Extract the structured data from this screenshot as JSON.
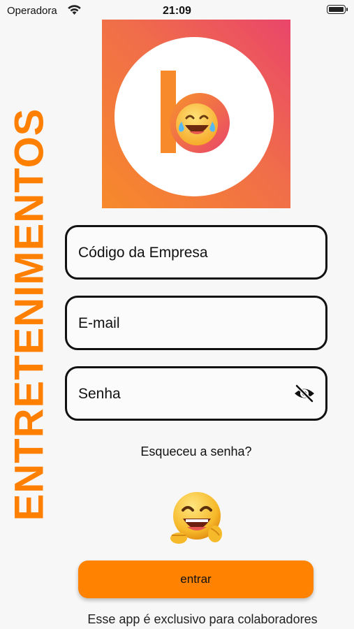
{
  "status_bar": {
    "carrier": "Operadora",
    "time": "21:09",
    "battery_level": 1.0
  },
  "brand": {
    "vertical_text": "ENTRETENIMENTOS",
    "logo_letter": "b",
    "accent_color": "#ff8200",
    "gradient_colors": [
      "#f78a2a",
      "#e9456a"
    ]
  },
  "form": {
    "company_code_placeholder": "Código da Empresa",
    "email_placeholder": "E-mail",
    "password_placeholder": "Senha",
    "password_toggle_icon": "eye-off-icon",
    "forgot_password": "Esqueceu a senha?",
    "submit_label": "entrar"
  },
  "footer": {
    "disclaimer": "Esse app é exclusivo para colaboradores"
  }
}
